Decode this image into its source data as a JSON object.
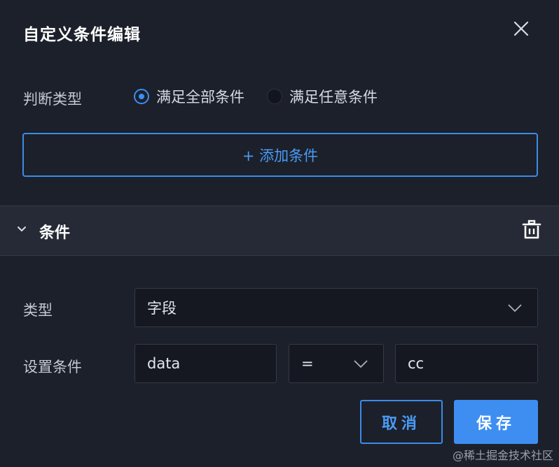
{
  "dialog": {
    "title": "自定义条件编辑"
  },
  "judge_type": {
    "label": "判断类型",
    "options": [
      {
        "label": "满足全部条件",
        "selected": true
      },
      {
        "label": "满足任意条件",
        "selected": false
      }
    ]
  },
  "add_condition": {
    "label": "+ 添加条件"
  },
  "condition_panel": {
    "title": "条件",
    "expanded": true
  },
  "type_field": {
    "label": "类型",
    "value": "字段"
  },
  "set_condition": {
    "label": "设置条件",
    "field_value": "data",
    "operator": "=",
    "compare_value": "cc"
  },
  "actions": {
    "cancel": "取消",
    "save": "保存"
  },
  "watermark": "@稀土掘金技术社区",
  "colors": {
    "background": "#1c202b",
    "accent": "#3d8ef0",
    "input_bg": "#151821",
    "panel_header_bg": "#252a36"
  }
}
